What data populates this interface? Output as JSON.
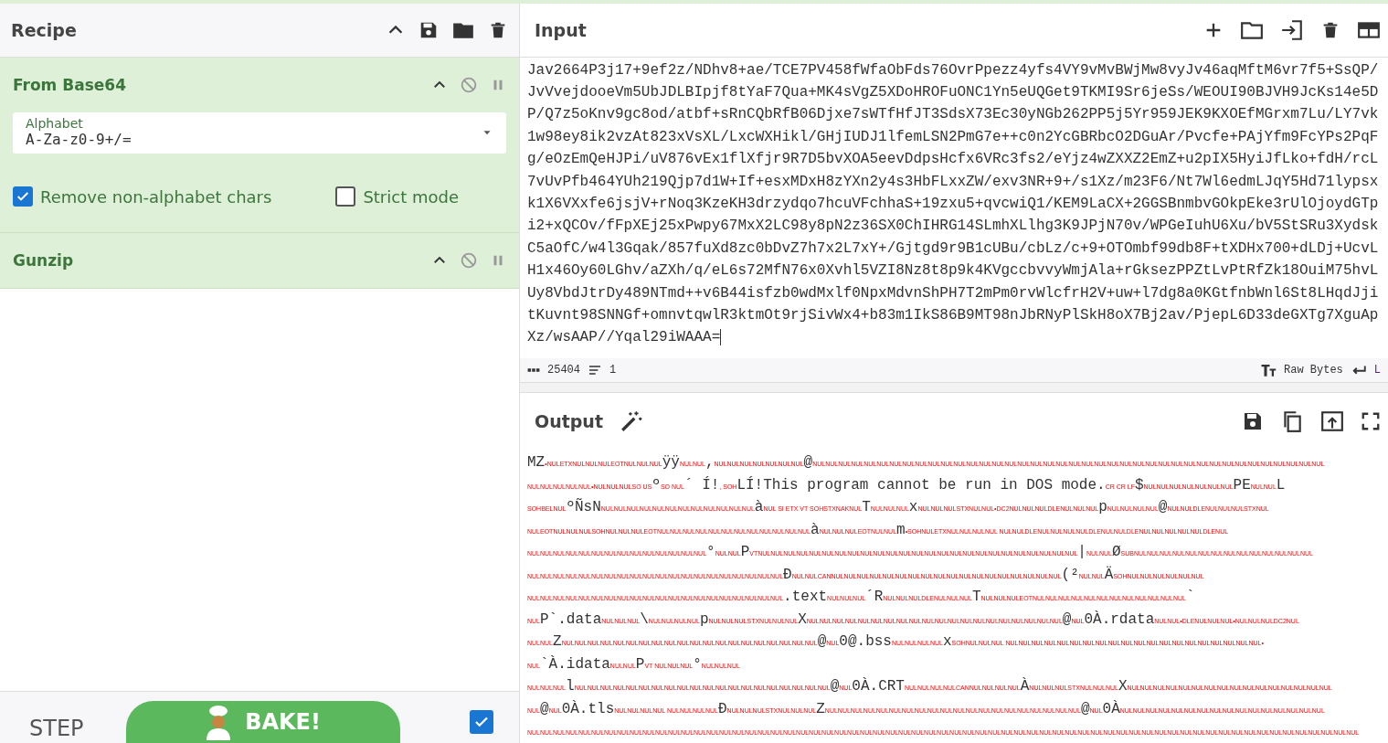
{
  "recipe": {
    "title": "Recipe",
    "operations": [
      {
        "name": "From Base64",
        "expanded": true,
        "field": {
          "label": "Alphabet",
          "value": "A-Za-z0-9+/="
        },
        "options": [
          {
            "label": "Remove non-alphabet chars",
            "checked": true
          },
          {
            "label": "Strict mode",
            "checked": false
          }
        ]
      },
      {
        "name": "Gunzip",
        "expanded": true
      }
    ],
    "controls": {
      "step": "STEP",
      "bake": "BAKE!",
      "auto_bake": true
    }
  },
  "input": {
    "title": "Input",
    "lines": [
      "Jav2664P3j17+9ef2z/NDhv8+ae/TCE7PV458fWfaObFds76OvrPpezz4yfs4VY9vMvBWjMw8vyJv46aqMftM6vr7f5+SsQP/",
      "JvVvejdooeVm5UbJDLBIpjf8tYaF7Qua+MK4sVgZ5XDoHROFuONC1Yn5eUQGet9TKMI9Sr6jeSs/WEOUI90BJVH9JcKs14e5D",
      "P/Q7z5oKnv9gc8od/atbf+sRnCQbRfB06Djxe7sWTfHfJT3SdsX73Ec30yNGb262PP5j5Yr959JEK9KXOEfMGrxm7Lu/LY7vk",
      "1w98ey8ik2vzAt823xVsXL/LxcWXHikl/GHjIUDJ1lfemLSN2PmG7e++c0n2YcGBRbcO2DGuAr/Pvcfe+PAjYfm9FcYPs2PqF",
      "g/eOzEmQeHJPi/uV876vEx1flXfjr9R7D5bvXOA5eevDdpsHcfx6VRc3fs2/eYjz4wZXXZ2EmZ+u2pIX5HyiJfLko+fdH/rcL",
      "7vUvPfb464YUh219Qjp7d1W+If+esxMDxH8zYXn2y4s3HbFLxxZW/exv3NR+9+/s1Xz/m23F6/Nt7Wl6edmLJqY5Hd71lypsx",
      "k1X6VXxfe6jsjV+rNoq3KzeKH3drzydqo7hcuVFchhaS+19zxu5+qvcwiQ1/KEM9LaCX+2GGSBnmbvGOkpEke3rUlOjoydGTp",
      "i2+xQCOv/fFpXEj25xPwpy67MxX2LC98y8pN2z36SX0ChIHRG14SLmhXLlhg3K9JPjN70v/WPGeIuhU6Xu/bV5StSRu3Xydsk",
      "C5aOfC/w4l3Gqak/857fuXd8zc0bDvZ7h7x2L7xY+/Gjtgd9r9B1cUBu/cbLz/c+9+OTOmbf99db8F+tXDHx700+dLDj+UcvL",
      "H1x46Oy60LGhv/aZXh/q/eL6s72MfN76x0Xvhl5VZI8Nz8t8p9k4KVgccbvvyWmjAla+rGksezPPZtLvPtRfZk18OuiM75hvL",
      "Uy8VbdJtrDy489NTmd++v6B44isfzb0wdMxlf0NpxMdvnShPH7T2mPm0rvWlcfrH2V+uw+l7dg8a0KGtfnbWnl6St8LHqdJji",
      "tKuvnt98SNNGf+omnvtqwlR3ktmOt9rjSivWx4+b83m1IkS86B9MT98nJbRNyPlSkH8oX7Bj2av/PjepL6D33deGXTg7XguAp",
      "Xz/wsAAP//Yqal29iWAAA="
    ],
    "status": {
      "length": "25404",
      "lines": "1",
      "encoding": "Raw Bytes",
      "eol": "L"
    }
  },
  "output": {
    "title": "Output",
    "lines": [
      [
        {
          "kind": "text",
          "text": "MZ"
        },
        {
          "kind": "ctrl",
          "text": "•NULETXNULNULNULEOTNULNULNUL"
        },
        {
          "kind": "text",
          "text": "ÿÿ"
        },
        {
          "kind": "ctrl",
          "text": "NULNUL"
        },
        {
          "kind": "text",
          "text": ","
        },
        {
          "kind": "ctrl",
          "text": "NULNULNULNULNULNULNUL"
        },
        {
          "kind": "text",
          "text": "@"
        },
        {
          "kind": "ctrl",
          "text": "NULNULNULNULNULNULNULNULNULNULNULNULNULNULNULNULNULNULNULNULNULNULNULNULNULNULNULNULNULNULNULNULNULNULNULNULNULNULNULNUL"
        }
      ],
      [
        {
          "kind": "ctrl",
          "text": "NULNULNULNULNUL•NULNULNULSO US"
        },
        {
          "kind": "text",
          "text": "º"
        },
        {
          "kind": "ctrl",
          "text": "SO NUL"
        },
        {
          "kind": "text",
          "text": "´ Í!"
        },
        {
          "kind": "ctrl",
          "text": ", SOH"
        },
        {
          "kind": "text",
          "text": "LÍ!This program cannot be run in DOS mode."
        },
        {
          "kind": "ctrl",
          "text": "CR CR LF"
        },
        {
          "kind": "text",
          "text": "$"
        },
        {
          "kind": "ctrl",
          "text": "NULNULNULNULNULNULNUL"
        },
        {
          "kind": "text",
          "text": "PE"
        },
        {
          "kind": "ctrl",
          "text": "NULNUL"
        },
        {
          "kind": "text",
          "text": "L"
        }
      ],
      [
        {
          "kind": "ctrl",
          "text": "SOHBELNUL"
        },
        {
          "kind": "text",
          "text": "ºÑsN"
        },
        {
          "kind": "ctrl",
          "text": "NULNULNULNULNULNULNULNULNULNULNULNUL"
        },
        {
          "kind": "text",
          "text": "à"
        },
        {
          "kind": "ctrl",
          "text": "NUL SI ETX VT SOHSTXNAKNUL"
        },
        {
          "kind": "text",
          "text": "T"
        },
        {
          "kind": "ctrl",
          "text": "NULNULNUL"
        },
        {
          "kind": "text",
          "text": "x"
        },
        {
          "kind": "ctrl",
          "text": "NULNULNULSTXNULNUL•DC2NULNULNULDLENULNULNUL"
        },
        {
          "kind": "text",
          "text": "p"
        },
        {
          "kind": "ctrl",
          "text": "NULNULNULNUL"
        },
        {
          "kind": "text",
          "text": "@"
        },
        {
          "kind": "ctrl",
          "text": "NULNULDLENULNULNULSTXNUL"
        }
      ],
      [
        {
          "kind": "ctrl",
          "text": "NULEOTNULNULNULSOHNULNULNULEOTNULNULNULNULNULNULNULNULNULNULNULNUL"
        },
        {
          "kind": "text",
          "text": "à"
        },
        {
          "kind": "ctrl",
          "text": "NULNULNULEOTNULNUL"
        },
        {
          "kind": "text",
          "text": "m"
        },
        {
          "kind": "ctrl",
          "text": "•SOHNULETXNULNULNULNUL  NULNULDLENULNULNULNULDLENULNULDLENULNULNULNULNULDLENUL"
        }
      ],
      [
        {
          "kind": "ctrl",
          "text": "NULNULNULNULNULNULNULNULNULNULNULNULNULNUL"
        },
        {
          "kind": "text",
          "text": "°"
        },
        {
          "kind": "ctrl",
          "text": "NULNUL"
        },
        {
          "kind": "text",
          "text": "P"
        },
        {
          "kind": "ctrl",
          "text": "VTNULNULNULNULNULNULNULNULNULNULNULNULNULNULNULNULNULNULNULNULNULNULNULNULNUL"
        },
        {
          "kind": "text",
          "text": "|"
        },
        {
          "kind": "ctrl",
          "text": "NULNUL"
        },
        {
          "kind": "text",
          "text": "Ø"
        },
        {
          "kind": "ctrl",
          "text": "SUBNULNULNULNULNULNULNULNULNULNULNULNULNULNUL"
        }
      ],
      [
        {
          "kind": "ctrl",
          "text": "NULNULNULNULNULNULNULNULNULNULNULNULNULNULNULNULNULNULNULNUL"
        },
        {
          "kind": "text",
          "text": "Đ"
        },
        {
          "kind": "ctrl",
          "text": "NULNULCANNULNULNULNULNULNULNULNULNULNULNULNULNULNULNULNULNULNUL"
        },
        {
          "kind": "text",
          "text": "(²"
        },
        {
          "kind": "ctrl",
          "text": "NULNUL"
        },
        {
          "kind": "text",
          "text": "Ä"
        },
        {
          "kind": "ctrl",
          "text": "SOHNULNULNULNULNULNUL"
        }
      ],
      [
        {
          "kind": "ctrl",
          "text": "NULNULNULNULNULNULNULNULNULNULNULNULNULNULNULNULNULNULNULNUL"
        },
        {
          "kind": "text",
          "text": ".text"
        },
        {
          "kind": "ctrl",
          "text": "NULNULNUL"
        },
        {
          "kind": "text",
          "text": "´R"
        },
        {
          "kind": "ctrl",
          "text": "NULNULNULDLENULNULNUL"
        },
        {
          "kind": "text",
          "text": "T"
        },
        {
          "kind": "ctrl",
          "text": "NULNULNULEOTNULNULNULNULNULNULNULNULNULNULNULNUL"
        },
        {
          "kind": "text",
          "text": "`"
        }
      ],
      [
        {
          "kind": "ctrl",
          "text": "NUL"
        },
        {
          "kind": "text",
          "text": "P`.data"
        },
        {
          "kind": "ctrl",
          "text": "NULNULNUL"
        },
        {
          "kind": "text",
          "text": "\\"
        },
        {
          "kind": "ctrl",
          "text": "NULNULNULNUL"
        },
        {
          "kind": "text",
          "text": "p"
        },
        {
          "kind": "ctrl",
          "text": "NULNULNULSTXNULNULNUL"
        },
        {
          "kind": "text",
          "text": "X"
        },
        {
          "kind": "ctrl",
          "text": "NULNULNULNULNULNULNULNULNULNULNULNULNULNULNULNULNULNULNULNUL"
        },
        {
          "kind": "text",
          "text": "@"
        },
        {
          "kind": "ctrl",
          "text": "NUL"
        },
        {
          "kind": "text",
          "text": "0À.rdata"
        },
        {
          "kind": "ctrl",
          "text": "NULNUL•DLENULNULNUL•NULNULNULDC2NUL"
        }
      ],
      [
        {
          "kind": "ctrl",
          "text": "NULNUL"
        },
        {
          "kind": "text",
          "text": "Z"
        },
        {
          "kind": "ctrl",
          "text": "NULNULNULNULNULNULNULNULNULNULNULNULNULNULNULNULNULNULNULNUL"
        },
        {
          "kind": "text",
          "text": "@"
        },
        {
          "kind": "ctrl",
          "text": "NUL"
        },
        {
          "kind": "text",
          "text": "0@.bss"
        },
        {
          "kind": "ctrl",
          "text": "NULNULNULNUL"
        },
        {
          "kind": "text",
          "text": "x"
        },
        {
          "kind": "ctrl",
          "text": "SOHNULNULNUL  NULNULNULNULNULNULNULNULNULNULNULNULNULNULNULNULNULNULNULNUL•"
        }
      ],
      [
        {
          "kind": "ctrl",
          "text": "NUL"
        },
        {
          "kind": "text",
          "text": "`À.idata"
        },
        {
          "kind": "ctrl",
          "text": "NULNUL"
        },
        {
          "kind": "text",
          "text": "P"
        },
        {
          "kind": "ctrl",
          "text": "VT NULNULNUL"
        },
        {
          "kind": "text",
          "text": "°"
        },
        {
          "kind": "ctrl",
          "text": "NULNULNUL"
        }
      ],
      [
        {
          "kind": "ctrl",
          "text": "NULNULNUL"
        },
        {
          "kind": "text",
          "text": "l"
        },
        {
          "kind": "ctrl",
          "text": "NULNULNULNULNULNULNULNULNULNULNULNULNULNULNULNULNULNULNULNUL"
        },
        {
          "kind": "text",
          "text": "@"
        },
        {
          "kind": "ctrl",
          "text": "NUL"
        },
        {
          "kind": "text",
          "text": "0À.CRT"
        },
        {
          "kind": "ctrl",
          "text": "NULNULNULNULCANNULNULNULNUL"
        },
        {
          "kind": "text",
          "text": "À"
        },
        {
          "kind": "ctrl",
          "text": "NULNULNULSTXNULNULNUL"
        },
        {
          "kind": "text",
          "text": "X"
        },
        {
          "kind": "ctrl",
          "text": "NULNULNULNULNULNULNULNULNULNULNULNULNULNULNULNUL"
        }
      ],
      [
        {
          "kind": "ctrl",
          "text": "NUL"
        },
        {
          "kind": "text",
          "text": "@"
        },
        {
          "kind": "ctrl",
          "text": "NUL"
        },
        {
          "kind": "text",
          "text": "0À.tls"
        },
        {
          "kind": "ctrl",
          "text": "NULNULNULNUL  NULNULNULNUL"
        },
        {
          "kind": "text",
          "text": "Đ"
        },
        {
          "kind": "ctrl",
          "text": "NULNULNULSTXNULNULNUL"
        },
        {
          "kind": "text",
          "text": "Z"
        },
        {
          "kind": "ctrl",
          "text": "NULNULNULNULNULNULNULNULNULNULNULNULNULNULNULNULNULNULNULNUL"
        },
        {
          "kind": "text",
          "text": "@"
        },
        {
          "kind": "ctrl",
          "text": "NUL"
        },
        {
          "kind": "text",
          "text": "0À"
        },
        {
          "kind": "ctrl",
          "text": "NULNULNULNULNULNULNULNULNULNULNULNULNULNULNULNUL"
        }
      ],
      [
        {
          "kind": "ctrl",
          "text": "NULNULNULNULNULNULNULNULNULNULNULNULNULNULNULNULNULNULNULNULNULNULNULNULNULNULNULNULNULNULNULNULNULNULNULNULNULNULNULNULNULNULNULNULNULNULNULNULNULNULNULNULNULNULNULNULNULNULNULNULNULNULNULNULNUL"
        }
      ]
    ]
  }
}
